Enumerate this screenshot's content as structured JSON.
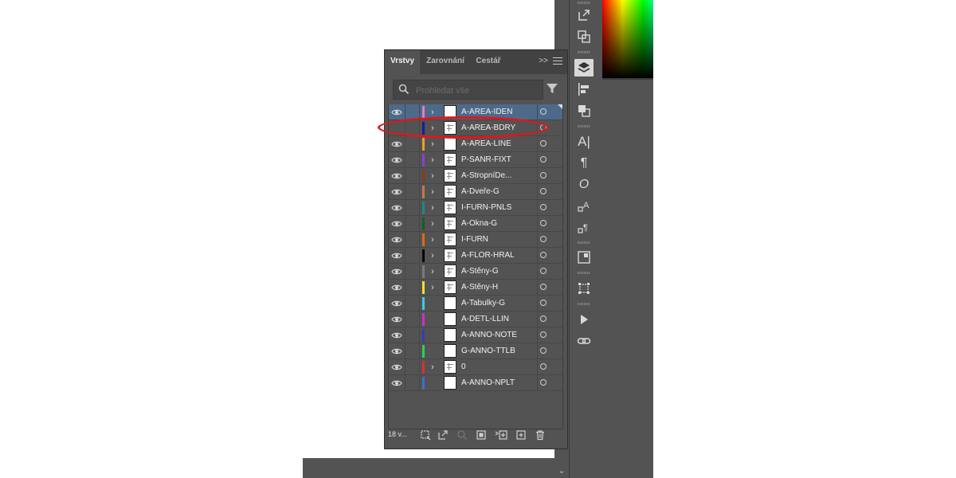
{
  "panel": {
    "tabs": [
      {
        "label": "Vrstvy"
      },
      {
        "label": "Zarovnání"
      },
      {
        "label": "Cestář"
      }
    ],
    "more_label": ">>",
    "search_placeholder": "Prohledat vše",
    "layer_count": "18 v...",
    "layers": [
      {
        "name": "A-AREA-IDEN",
        "color": "#e47fbb",
        "visible": true,
        "expandable": true,
        "selected": true
      },
      {
        "name": "A-AREA-BDRY",
        "color": "#1a1a9a",
        "visible": false,
        "expandable": true,
        "selected": false
      },
      {
        "name": "A-AREA-LINE",
        "color": "#f0a020",
        "visible": true,
        "expandable": true,
        "selected": false
      },
      {
        "name": "P-SANR-FIXT",
        "color": "#8a3fd0",
        "visible": true,
        "expandable": true,
        "selected": false
      },
      {
        "name": "A-StropníDe...",
        "color": "#8a3a1a",
        "visible": true,
        "expandable": true,
        "selected": false
      },
      {
        "name": "A-Dveře-G",
        "color": "#c07a4a",
        "visible": true,
        "expandable": true,
        "selected": false
      },
      {
        "name": "I-FURN-PNLS",
        "color": "#1a8a8a",
        "visible": true,
        "expandable": true,
        "selected": false
      },
      {
        "name": "A-Okna-G",
        "color": "#1a5a2a",
        "visible": true,
        "expandable": true,
        "selected": false
      },
      {
        "name": "I-FURN",
        "color": "#e06a10",
        "visible": true,
        "expandable": true,
        "selected": false
      },
      {
        "name": "A-FLOR-HRAL",
        "color": "#000000",
        "visible": true,
        "expandable": true,
        "selected": false
      },
      {
        "name": "A-Stěny-G",
        "color": "#7a7a7a",
        "visible": true,
        "expandable": true,
        "selected": false
      },
      {
        "name": "A-Stěny-H",
        "color": "#f0e030",
        "visible": true,
        "expandable": true,
        "selected": false
      },
      {
        "name": "A-Tabulky-G",
        "color": "#40c8e0",
        "visible": true,
        "expandable": false,
        "selected": false
      },
      {
        "name": "A-DETL-LLIN",
        "color": "#d030c0",
        "visible": true,
        "expandable": false,
        "selected": false
      },
      {
        "name": "A-ANNO-NOTE",
        "color": "#3a3ab0",
        "visible": true,
        "expandable": false,
        "selected": false
      },
      {
        "name": "G-ANNO-TTLB",
        "color": "#30d050",
        "visible": true,
        "expandable": false,
        "selected": false
      },
      {
        "name": "0",
        "color": "#d83030",
        "visible": true,
        "expandable": true,
        "selected": false
      },
      {
        "name": "A-ANNO-NPLT",
        "color": "#3a70d0",
        "visible": true,
        "expandable": false,
        "selected": false
      }
    ]
  },
  "icons": {
    "eye": "eye-icon",
    "chevron": "chevron-right-icon"
  }
}
